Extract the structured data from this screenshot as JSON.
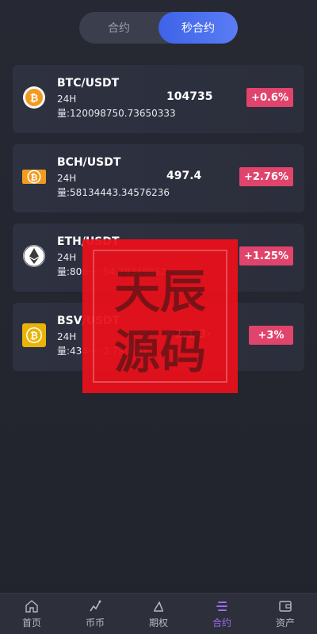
{
  "tabs": [
    {
      "label": "合约",
      "active": false
    },
    {
      "label": "秒合约",
      "active": true
    }
  ],
  "markets": [
    {
      "icon": "bitcoin-icon",
      "pair": "BTC/USDT",
      "period": "24H",
      "volume": "量:120098750.73650333",
      "price": "104735",
      "change": "+0.6%"
    },
    {
      "icon": "bitcoin-cash-icon",
      "pair": "BCH/USDT",
      "period": "24H",
      "volume": "量:58134443.34576236",
      "price": "497.4",
      "change": "+2.76%"
    },
    {
      "icon": "ethereum-icon",
      "pair": "ETH/USDT",
      "period": "24H",
      "volume": "量:806·····54.79349862",
      "price": "",
      "change": "+1.25%"
    },
    {
      "icon": "bitcoin-sv-icon",
      "pair": "BSV/USDT",
      "period": "24H",
      "volume": "量:434·····2.79·7·91",
      "price": "··2.1·3·",
      "change": "+3%"
    }
  ],
  "watermark": {
    "text": "天辰源码",
    "color": "#e8101a"
  },
  "nav": [
    {
      "label": "首页",
      "icon": "home-icon",
      "active": false
    },
    {
      "label": "币币",
      "icon": "exchange-icon",
      "active": false
    },
    {
      "label": "期权",
      "icon": "options-icon",
      "active": false
    },
    {
      "label": "合约",
      "icon": "contract-icon",
      "active": true
    },
    {
      "label": "资产",
      "icon": "wallet-icon",
      "active": false
    }
  ],
  "colors": {
    "accent": "#4a6ef0",
    "change_up": "#e0446c",
    "nav_active": "#9b6cf0"
  }
}
